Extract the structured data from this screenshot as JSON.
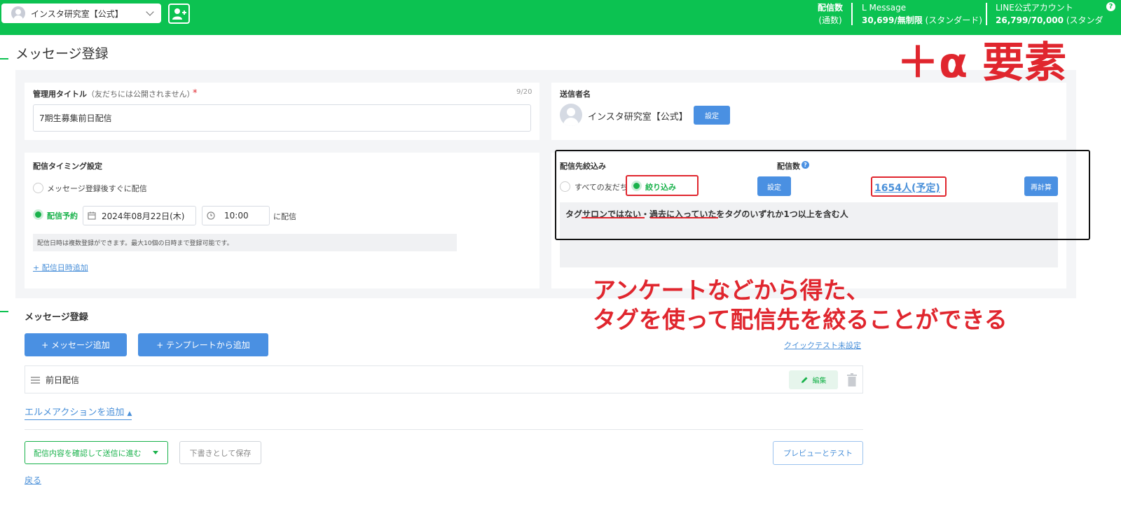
{
  "header": {
    "account_name": "インスタ研究室【公式】",
    "stat1_label": "配信数",
    "stat1_sub": "(通数)",
    "stat2_label": "L Message",
    "stat2_value": "30,699/無制限",
    "stat2_plan": " (スタンダード)",
    "stat3_label": "LINE公式アカウント",
    "stat3_value": "26,799/70,000",
    "stat3_plan": " (スタンダ",
    "help": "?"
  },
  "page": {
    "title": "メッセージ登録"
  },
  "admin_title": {
    "label": "管理用タイトル",
    "note": "（友だちには公開されません）",
    "required_mark": "*",
    "counter": "9/20",
    "value": "7期生募集前日配信"
  },
  "sender": {
    "label": "送信者名",
    "name": "インスタ研究室【公式】",
    "set_button": "設定"
  },
  "timing": {
    "label": "配信タイミング設定",
    "option_immediate": "メッセージ登録後すぐに配信",
    "option_scheduled": "配信予約",
    "date": "2024年08月22日(木)",
    "time": "10:00",
    "suffix": "に配信",
    "note": "配信日時は複数登録ができます。最大10個の日時まで登録可能です。",
    "add_link": "+ 配信日時追加"
  },
  "target": {
    "label": "配信先絞込み",
    "option_all": "すべての友だち",
    "option_filter": "絞り込み",
    "set_button": "設定",
    "count_label": "配信数",
    "help": "?",
    "count_value": "1654人(予定)",
    "recalc_button": "再計算",
    "condition_text": "タグサロンではない・過去に入っていたをタグのいずれか1つ以上を含む人"
  },
  "annotations": {
    "plus_alpha": "＋α 要素",
    "caption_line1": "アンケートなどから得た、",
    "caption_line2": "タグを使って配信先を絞ることができる"
  },
  "messages": {
    "section_title": "メッセージ登録",
    "add_message_button": "+ メッセージ追加",
    "add_template_button": "+ テンプレートから追加",
    "quick_test_link": "クイックテスト未設定",
    "items": [
      {
        "name": "前日配信",
        "edit_label": "編集"
      }
    ],
    "action_link": "エルメアクションを追加",
    "action_arrow": "▲"
  },
  "footer": {
    "confirm_button": "配信内容を確認して送信に進む",
    "draft_button": "下書きとして保存",
    "preview_button": "プレビューとテスト",
    "back_link": "戻る"
  },
  "colors": {
    "brand_green": "#0cc251",
    "accent_blue": "#4a90e2",
    "annotation_red": "#e0262e"
  }
}
